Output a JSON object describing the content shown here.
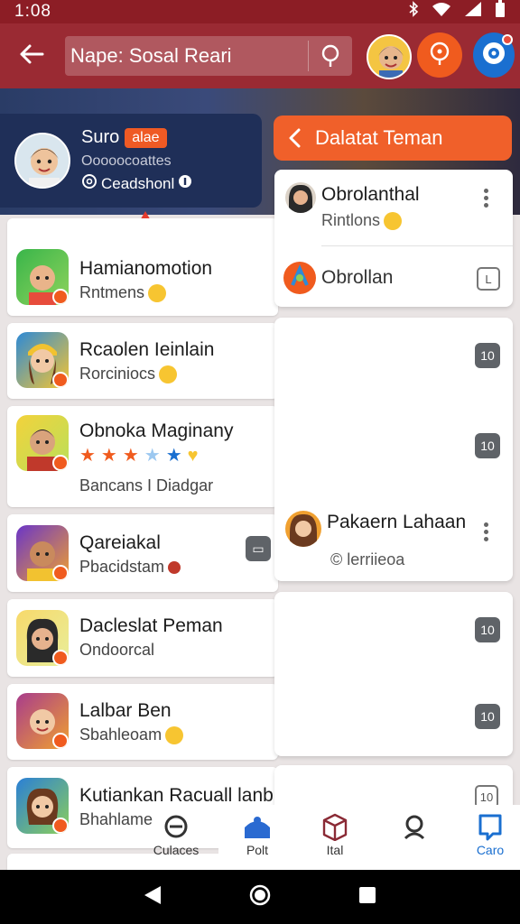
{
  "status_bar": {
    "time": "1:08"
  },
  "app_bar": {
    "title": "Nape: Sosal Reari"
  },
  "profile": {
    "name": "Suro",
    "tag": "alae",
    "subtitle": "Ooooocoattes",
    "meta": "Ceadshonl"
  },
  "list_items": [
    {
      "title": "Hamianomotion",
      "subtitle": "Rntmens",
      "colors": [
        "#39b54a",
        "#f7c531"
      ]
    },
    {
      "title": "Rcaolen Ieinlain",
      "subtitle": "Rorciniocs",
      "colors": [
        "#2d8ad6",
        "#f7c531"
      ]
    },
    {
      "title": "Obnoka Maginany",
      "subtitle": "Bancans I Diadgar",
      "colors": [
        "#f3d23b",
        "#c0392b"
      ]
    },
    {
      "title": "Qareiakal",
      "subtitle": "Pbacidstam",
      "colors": [
        "#6a35c8",
        "#f0a030"
      ]
    },
    {
      "title": "Dacleslat Peman",
      "subtitle": "Ondoorcal",
      "colors": [
        "#f7d96b",
        "#333333"
      ]
    },
    {
      "title": "Lalbar Ben",
      "subtitle": "Sbahleoam",
      "colors": [
        "#a83c8c",
        "#f0a030"
      ]
    },
    {
      "title": "Kutiankan Racuall lanb",
      "subtitle": "Bhahlame",
      "colors": [
        "#2a7fd6",
        "#8ccf5a"
      ]
    }
  ],
  "drawer": {
    "header": "Dalatat Teman",
    "card1": {
      "item1_title": "Obrolanthal",
      "item1_sub": "Rintlons",
      "item2_title": "Obrollan",
      "item2_button": "L"
    },
    "card2": {
      "buttons": [
        "10",
        "10"
      ],
      "title": "Pakaern Lahaan",
      "sub": "lerriieoa"
    },
    "card3": {
      "buttons": [
        "10",
        "10"
      ]
    },
    "card4": {
      "button": "10"
    }
  },
  "bottom_nav": {
    "items": [
      "Culaces",
      "Polt",
      "Ital",
      "",
      "Caro"
    ]
  }
}
